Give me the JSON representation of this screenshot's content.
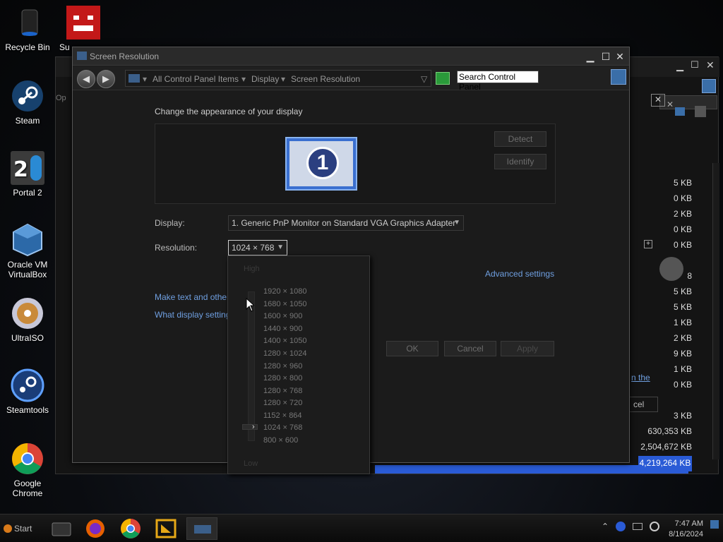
{
  "desktop": {
    "icons": [
      {
        "label": "Recycle Bin",
        "icon": "recycle-bin-icon"
      },
      {
        "label": "Su",
        "icon": "super-meat-boy-icon"
      },
      {
        "label": "Steam",
        "icon": "steam-icon"
      },
      {
        "label": "Portal 2",
        "icon": "portal2-icon"
      },
      {
        "label": "Oracle VM VirtualBox",
        "icon": "virtualbox-icon"
      },
      {
        "label": "UltraISO",
        "icon": "ultraiso-icon"
      },
      {
        "label": "Steamtools",
        "icon": "steamtools-icon"
      },
      {
        "label": "Google Chrome",
        "icon": "chrome-icon"
      }
    ]
  },
  "background_window": {
    "tab_label": "Op",
    "sizes": [
      "5 KB",
      "0 KB",
      "2 KB",
      "0 KB",
      "0 KB",
      "8",
      "5 KB",
      "5 KB",
      "1 KB",
      "2 KB",
      "9 KB",
      "1 KB",
      "0 KB",
      "3 KB",
      "630,353 KB",
      "2,504,672 KB",
      "4,219,264 KB"
    ],
    "link_fragment": "n the",
    "button_fragment": "cel"
  },
  "window": {
    "title": "Screen Resolution",
    "breadcrumb": [
      "All Control Panel Items",
      "Display",
      "Screen Resolution"
    ],
    "search_placeholder": "Search Control Panel",
    "heading": "Change the appearance of your display",
    "monitor_number": "1",
    "detect_label": "Detect",
    "identify_label": "Identify",
    "display_label": "Display:",
    "display_value": "1. Generic PnP Monitor on Standard VGA Graphics Adapter",
    "resolution_label": "Resolution:",
    "resolution_value": "1024 × 768",
    "advanced_link": "Advanced settings",
    "link1": "Make text and other",
    "link2": "What display setting",
    "ok_label": "OK",
    "cancel_label": "Cancel",
    "apply_label": "Apply"
  },
  "dropdown": {
    "high_label": "High",
    "low_label": "Low",
    "options": [
      "1920 × 1080",
      "1680 × 1050",
      "1600 × 900",
      "1440 × 900",
      "1400 × 1050",
      "1280 × 1024",
      "1280 × 960",
      "1280 × 800",
      "1280 × 768",
      "1280 × 720",
      "1152 × 864",
      "1024 × 768",
      "800 × 600"
    ],
    "selected": "1024 × 768"
  },
  "taskbar": {
    "start_label": "Start",
    "time": "7:47 AM",
    "date": "8/16/2024"
  },
  "colors": {
    "accent": "#3a6ea8",
    "link": "#6f9fe0",
    "selection_bar": "#2a5bd6"
  }
}
